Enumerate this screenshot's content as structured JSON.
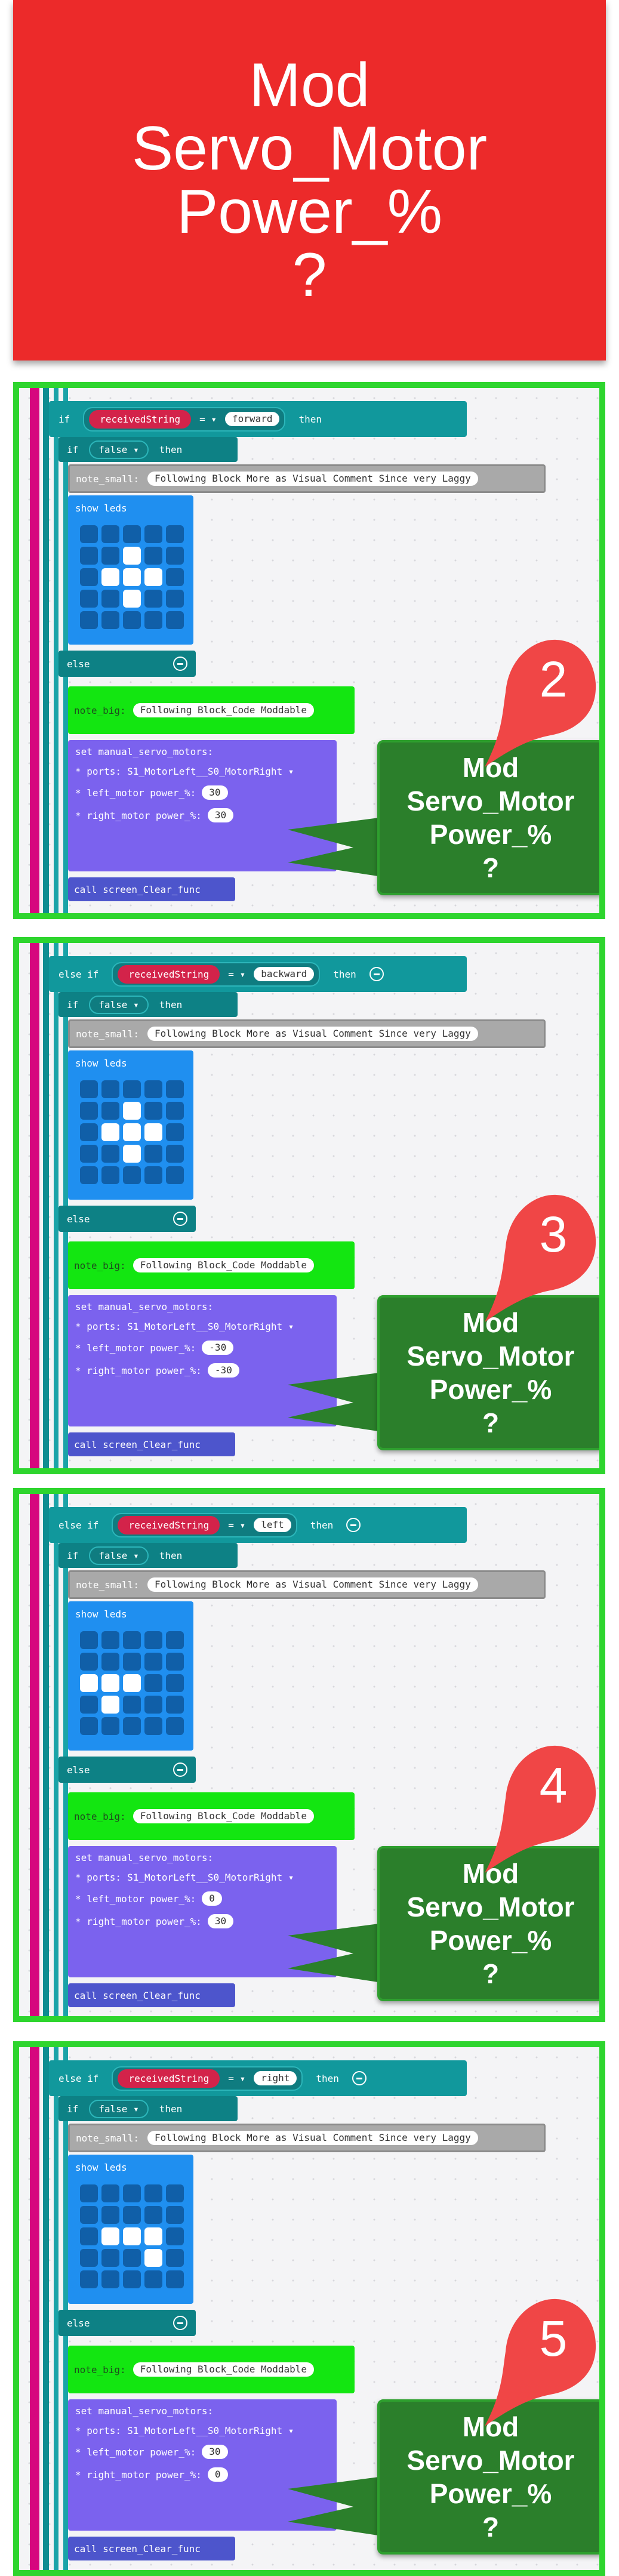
{
  "banner": {
    "lines": [
      "Mod",
      "Servo_Motor",
      "Power_%",
      "?"
    ]
  },
  "callout_lines": [
    "Mod",
    "Servo_Motor",
    "Power_%",
    "?"
  ],
  "common": {
    "if_kw": "if",
    "else_if_kw": "else if",
    "then_kw": "then",
    "else_kw": "else",
    "variable": "receivedString",
    "op": "= ▾",
    "false_val": "false ▾",
    "note_small": "note_small:",
    "note_small_text": "Following Block More as Visual Comment Since very Laggy",
    "show_leds": "show leds",
    "note_big": "note_big:",
    "note_big_text": "Following Block_Code Moddable",
    "servo_title": "set manual_servo_motors:",
    "ports_label": "* ports:",
    "ports_value": "S1_MotorLeft__S0_MotorRight ▾",
    "left_label": "* left_motor power_%:",
    "right_label": "* right_motor power_%:",
    "clear": "call screen_Clear_func"
  },
  "panels": [
    {
      "number": "2",
      "direction": "forward",
      "left_power": "30",
      "right_power": "30",
      "leds": [
        0,
        0,
        0,
        0,
        0,
        0,
        0,
        1,
        0,
        0,
        0,
        1,
        1,
        1,
        0,
        0,
        0,
        1,
        0,
        0,
        0,
        0,
        0,
        0,
        0
      ]
    },
    {
      "number": "3",
      "direction": "backward",
      "left_power": "-30",
      "right_power": "-30",
      "leds": [
        0,
        0,
        0,
        0,
        0,
        0,
        0,
        1,
        0,
        0,
        0,
        1,
        1,
        1,
        0,
        0,
        0,
        1,
        0,
        0,
        0,
        0,
        0,
        0,
        0
      ]
    },
    {
      "number": "4",
      "direction": "left",
      "left_power": "0",
      "right_power": "30",
      "leds": [
        0,
        0,
        0,
        0,
        0,
        0,
        0,
        0,
        0,
        0,
        1,
        1,
        1,
        0,
        0,
        0,
        1,
        0,
        0,
        0,
        0,
        0,
        0,
        0,
        0
      ]
    },
    {
      "number": "5",
      "direction": "right",
      "left_power": "30",
      "right_power": "0",
      "leds": [
        0,
        0,
        0,
        0,
        0,
        0,
        0,
        0,
        0,
        0,
        0,
        1,
        1,
        1,
        0,
        0,
        0,
        0,
        1,
        0,
        0,
        0,
        0,
        0,
        0
      ]
    }
  ],
  "colors": {
    "banner": "#ec2a2a",
    "frame": "#2ed52e",
    "callout": "#2b7f2b",
    "drop": "#f04646"
  }
}
